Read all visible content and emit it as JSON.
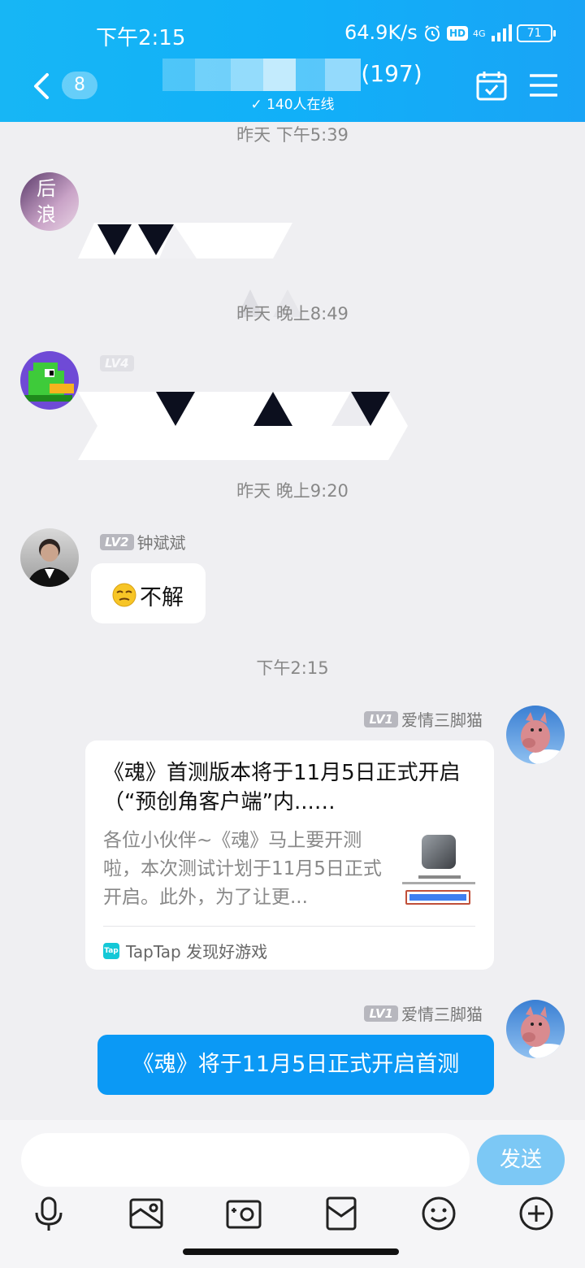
{
  "status_bar": {
    "time": "下午2:15",
    "net_speed": "64.9K/s",
    "hd": "HD",
    "network": "4G",
    "battery": "71"
  },
  "header": {
    "unread_count": "8",
    "group_title_suffix": "(197)",
    "online_text": "140人在线"
  },
  "messages": {
    "ts1": "昨天 下午5:39",
    "ts2": "昨天 晚上8:49",
    "ts3": "昨天 晚上9:20",
    "ts4": "下午2:15",
    "avatar1_text": "后浪",
    "user2_level": "LV4",
    "user3_level": "LV2",
    "user3_name": "钟斌斌",
    "user3_message": "不解",
    "user4_level": "LV1",
    "user4_name": "爱情三脚猫",
    "card": {
      "title": "《魂》首测版本将于11月5日正式开启（“预创角客户端”内...…",
      "description": "各位小伙伴~《魂》马上要开测啦，本次测试计划于11月5日正式开启。此外，为了让更...",
      "source": "TapTap 发现好游戏",
      "logo": "Tap"
    },
    "user5_level": "LV1",
    "user5_name": "爱情三脚猫",
    "last_message": "《魂》将于11月5日正式开启首测"
  },
  "input_bar": {
    "placeholder": "",
    "send_label": "发送"
  },
  "icons": {
    "tools": [
      "microphone-icon",
      "picture-icon",
      "camera-icon",
      "red-packet-icon",
      "emoji-icon",
      "plus-icon"
    ]
  },
  "colors": {
    "header": "#11b0f8",
    "bubble_blue": "#0b99f5",
    "send_button": "#7cc8f5",
    "background": "#efeff2"
  }
}
